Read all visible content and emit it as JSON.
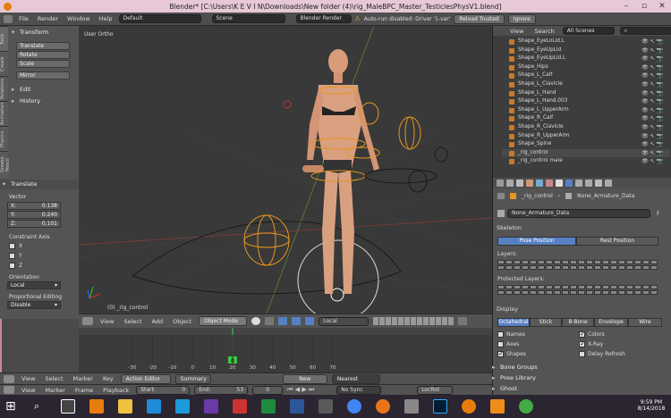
{
  "window": {
    "title": "Blender* [C:\\Users\\K E V I N\\Downloads\\New folder (4)\\rig_MaleBPC_Master_TesticlesPhysV1.blend]"
  },
  "topbar": {
    "menus": [
      "File",
      "Render",
      "Window",
      "Help"
    ],
    "layout": "Default",
    "scene": "Scene",
    "engine": "Blender Render",
    "autorun_warning": "Auto-run disabled: Driver '1-var'",
    "reload_trusted": "Reload Trusted",
    "ignore": "Ignore"
  },
  "toolshelf": {
    "tabs": [
      "Tools",
      "Create",
      "Relations",
      "Animation",
      "Physics",
      "Grease Pencil"
    ],
    "transform_header": "Transform",
    "buttons": [
      "Translate",
      "Rotate",
      "Scale"
    ],
    "mirror": "Mirror",
    "edit_header": "Edit",
    "history_header": "History"
  },
  "operator": {
    "header": "Translate",
    "vector_label": "Vector",
    "x_label": "X:",
    "x_value": "0.138",
    "y_label": "Y:",
    "y_value": "0.240",
    "z_label": "Z:",
    "z_value": "0.101",
    "constraint_label": "Constraint Axis",
    "axes": [
      "X",
      "Y",
      "Z"
    ],
    "orientation_label": "Orientation",
    "orientation_value": "Local",
    "prop_edit_label": "Proportional Editing",
    "prop_edit_value": "Disable"
  },
  "viewport": {
    "view_name": "User Ortho",
    "active_object": "(0) _rig_control"
  },
  "viewport_header": {
    "menus": [
      "View",
      "Select",
      "Add",
      "Object"
    ],
    "mode": "Object Mode",
    "orientation": "Local"
  },
  "timeline": {
    "ticks": [
      "-30",
      "-20",
      "-10",
      "0",
      "10",
      "20",
      "30",
      "40",
      "50",
      "60",
      "70"
    ],
    "current_frame": "0"
  },
  "dopesheet_bar": {
    "menus": [
      "View",
      "Select",
      "Marker",
      "Key"
    ],
    "editor": "Action Editor",
    "summary": "Summary",
    "new": "New",
    "nearest": "Nearest Frame"
  },
  "timeline_bar": {
    "menus": [
      "View",
      "Marker",
      "Frame",
      "Playback"
    ],
    "start": "Start:",
    "start_val": "0",
    "end": "End:",
    "end_val": "53",
    "current": "0",
    "sync": "No Sync",
    "locrot": "LocRot"
  },
  "outliner": {
    "menus": [
      "View",
      "Search"
    ],
    "filter": "All Scenes",
    "items": [
      "Shape_EyeLoLid.L",
      "Shape_EyeUpLid",
      "Shape_EyeUpLid.L",
      "Shape_Hips",
      "Shape_L_Calf",
      "Shape_L_Clavicle",
      "Shape_L_Hand",
      "Shape_L_Hand.003",
      "Shape_L_UpperArm",
      "Shape_R_Calf",
      "Shape_R_Clavicle",
      "Shape_R_UpperArm",
      "Shape_Spine",
      "_rig_control",
      "_rig_control male"
    ]
  },
  "properties": {
    "breadcrumb_obj": "_rig_control",
    "breadcrumb_data": "None_Armature_Data",
    "data_name": "None_Armature_Data",
    "f_label": "F",
    "skeleton_header": "Skeleton",
    "pose_position": "Pose Position",
    "rest_position": "Rest Position",
    "layers_label": "Layers:",
    "protected_label": "Protected Layers:",
    "display_header": "Display",
    "display_tabs": [
      "Octahedral",
      "Stick",
      "B-Bone",
      "Envelope",
      "Wire"
    ],
    "names": "Names",
    "colors": "Colors",
    "axes": "Axes",
    "xray": "X-Ray",
    "shapes": "Shapes",
    "delay": "Delay Refresh",
    "bone_groups": "Bone Groups",
    "pose_library": "Pose Library",
    "ghost": "Ghost"
  },
  "taskbar": {
    "time": "9:59 PM",
    "date": "8/14/2018"
  },
  "colors": {
    "selected_blue": "#5680c2",
    "frame_pink": "#c68aa2",
    "active_green": "#3ec43e",
    "bone_orange": "#e8951e"
  }
}
